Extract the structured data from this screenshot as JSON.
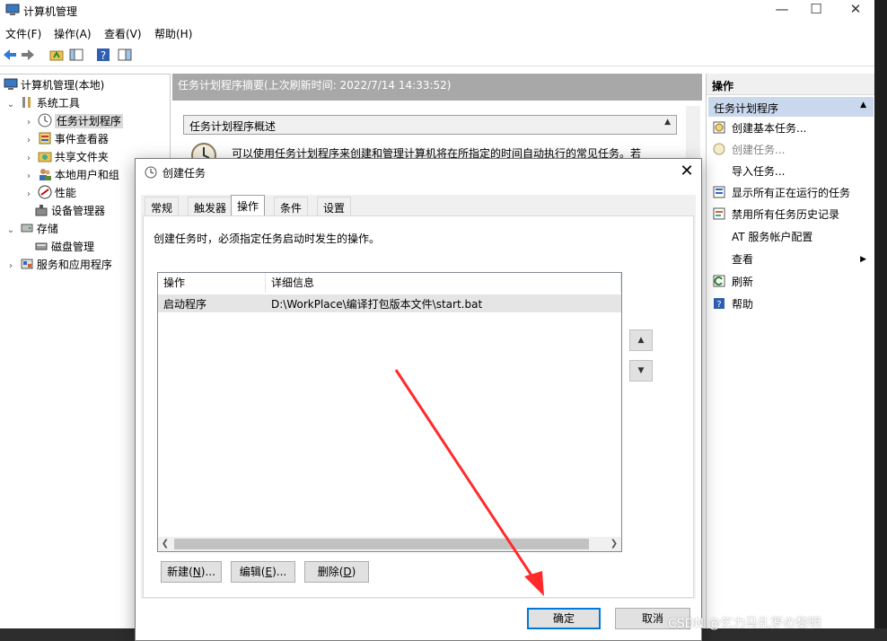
{
  "window": {
    "title": "计算机管理",
    "controls": {
      "minimize": "—",
      "maximize": "☐",
      "close": "✕"
    }
  },
  "menu": {
    "items": [
      "文件(F)",
      "操作(A)",
      "查看(V)",
      "帮助(H)"
    ]
  },
  "tree": {
    "root": "计算机管理(本地)",
    "items": [
      {
        "label": "系统工具",
        "icon": "tools-icon"
      },
      {
        "label": "任务计划程序",
        "icon": "clock-icon",
        "selected": true
      },
      {
        "label": "事件查看器",
        "icon": "event-viewer-icon"
      },
      {
        "label": "共享文件夹",
        "icon": "shared-folder-icon"
      },
      {
        "label": "本地用户和组",
        "icon": "users-icon"
      },
      {
        "label": "性能",
        "icon": "performance-icon"
      },
      {
        "label": "设备管理器",
        "icon": "device-manager-icon"
      },
      {
        "label": "存储",
        "icon": "storage-icon"
      },
      {
        "label": "磁盘管理",
        "icon": "disk-icon"
      },
      {
        "label": "服务和应用程序",
        "icon": "services-icon"
      }
    ]
  },
  "middle": {
    "header": "任务计划程序摘要(上次刷新时间: 2022/7/14 14:33:52)",
    "section_title": "任务计划程序概述",
    "description": "可以使用任务计划程序来创建和管理计算机将在所指定的时间自动执行的常见任务。若"
  },
  "actions": {
    "header": "操作",
    "group": "任务计划程序",
    "items": [
      {
        "label": "创建基本任务...",
        "icon": "create-basic-task-icon"
      },
      {
        "label": "创建任务...",
        "icon": "create-task-icon",
        "disabled": true
      },
      {
        "label": "导入任务...",
        "icon": ""
      },
      {
        "label": "显示所有正在运行的任务",
        "icon": "running-tasks-icon"
      },
      {
        "label": "禁用所有任务历史记录",
        "icon": "history-icon"
      },
      {
        "label": "AT 服务帐户配置",
        "icon": ""
      },
      {
        "label": "查看",
        "icon": "",
        "submenu": true
      },
      {
        "label": "刷新",
        "icon": "refresh-icon"
      },
      {
        "label": "帮助",
        "icon": "help-icon"
      }
    ]
  },
  "dialog": {
    "title": "创建任务",
    "tabs": [
      "常规",
      "触发器",
      "操作",
      "条件",
      "设置"
    ],
    "active_tab": "操作",
    "description": "创建任务时，必须指定任务启动时发生的操作。",
    "list": {
      "columns": [
        "操作",
        "详细信息"
      ],
      "rows": [
        {
          "action": "启动程序",
          "details": "D:\\WorkPlace\\编译打包版本文件\\start.bat"
        }
      ]
    },
    "buttons": {
      "new": {
        "text": "新建(",
        "key": "N",
        "suffix": ")..."
      },
      "edit": {
        "text": "编辑(",
        "key": "E",
        "suffix": ")..."
      },
      "delete": {
        "text": "删除(",
        "key": "D",
        "suffix": ")"
      },
      "ok": "确定",
      "cancel": "取消"
    }
  },
  "watermark": "CSDN @乞力马扎罗の黎明",
  "colors": {
    "selection_blue": "#c9d8ec",
    "header_gray": "#a8a8a8",
    "arrow_red": "#ff2a2a",
    "primary_border": "#0078d7"
  }
}
